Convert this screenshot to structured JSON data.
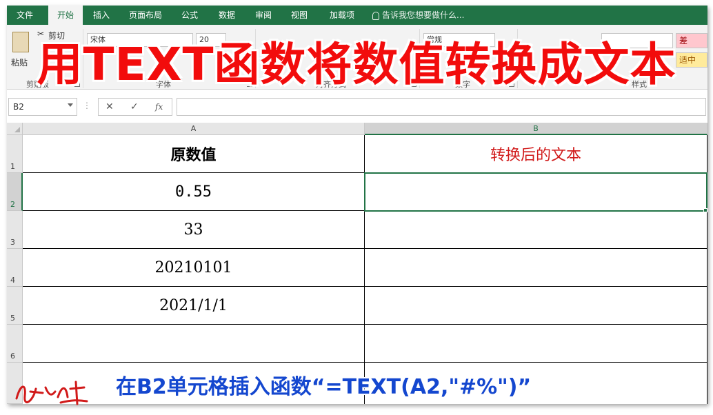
{
  "ribbon": {
    "tabs": [
      {
        "label": "文件"
      },
      {
        "label": "开始"
      },
      {
        "label": "插入"
      },
      {
        "label": "页面布局"
      },
      {
        "label": "公式"
      },
      {
        "label": "数据"
      },
      {
        "label": "审阅"
      },
      {
        "label": "视图"
      },
      {
        "label": "加载项"
      }
    ],
    "active_tab": "开始",
    "tell_me": "告诉我您想要做什么...",
    "clipboard": {
      "paste": "粘贴",
      "cut": "剪切",
      "group": "剪贴板"
    },
    "font": {
      "name": "宋体",
      "size": "20",
      "group": "字体"
    },
    "alignment": {
      "group": "对齐方式"
    },
    "number": {
      "format": "常规",
      "group": "数字"
    },
    "styles": {
      "bad": "差",
      "neutral": "适中",
      "group": "样式"
    }
  },
  "formula_bar": {
    "name_box": "B2",
    "cancel": "✕",
    "enter": "✓",
    "fx": "fx",
    "value": ""
  },
  "sheet": {
    "columns": [
      "A",
      "B"
    ],
    "selected_column": "B",
    "rows": [
      "1",
      "2",
      "3",
      "4",
      "5",
      "6"
    ],
    "selected_row": "2",
    "cells": {
      "A1": "原数值",
      "B1": "转换后的文本",
      "A2": "0.55",
      "B2": "",
      "A3": "33",
      "B3": "",
      "A4": "20210101",
      "B4": "",
      "A5": "2021/1/1",
      "B5": ""
    }
  },
  "overlay": {
    "title": "用TEXT函数将数值转换成文本",
    "caption": "在B2单元格插入函数“=TEXT(A2,\"#%\")”",
    "title_color": "#f20c0c",
    "caption_color": "#1447cf"
  },
  "colors": {
    "excel_green": "#217346",
    "header_red": "#d11a1a"
  }
}
